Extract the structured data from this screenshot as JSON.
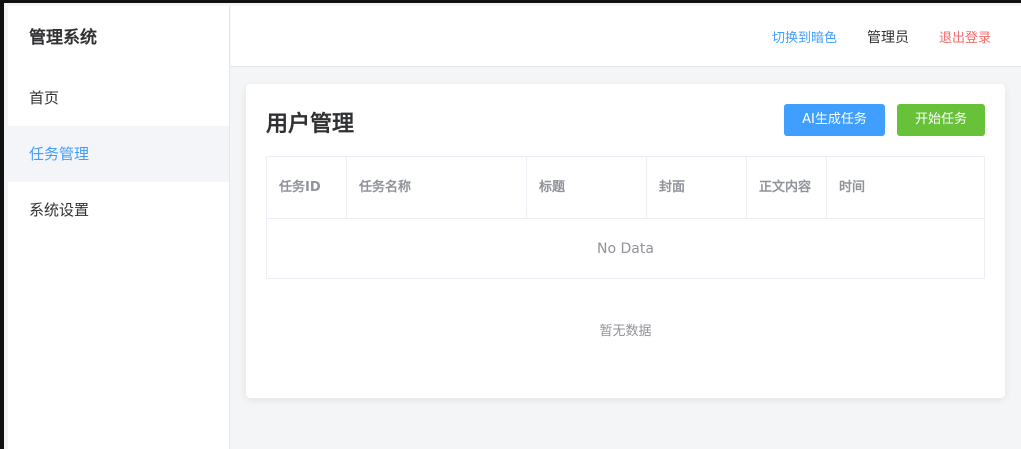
{
  "sidebar": {
    "brand": "管理系统",
    "items": [
      {
        "label": "首页"
      },
      {
        "label": "任务管理"
      },
      {
        "label": "系统设置"
      }
    ]
  },
  "header": {
    "theme_toggle": "切换到暗色",
    "user": "管理员",
    "logout": "退出登录"
  },
  "main": {
    "title": "用户管理",
    "ai_button": "AI生成任务",
    "start_button": "开始任务",
    "table": {
      "columns": [
        "任务ID",
        "任务名称",
        "标题",
        "封面",
        "正文内容",
        "时间"
      ],
      "no_data": "No Data"
    },
    "empty_text": "暂无数据"
  },
  "colors": {
    "accent": "#409eff",
    "success": "#67c23a",
    "danger": "#f56c6c"
  }
}
